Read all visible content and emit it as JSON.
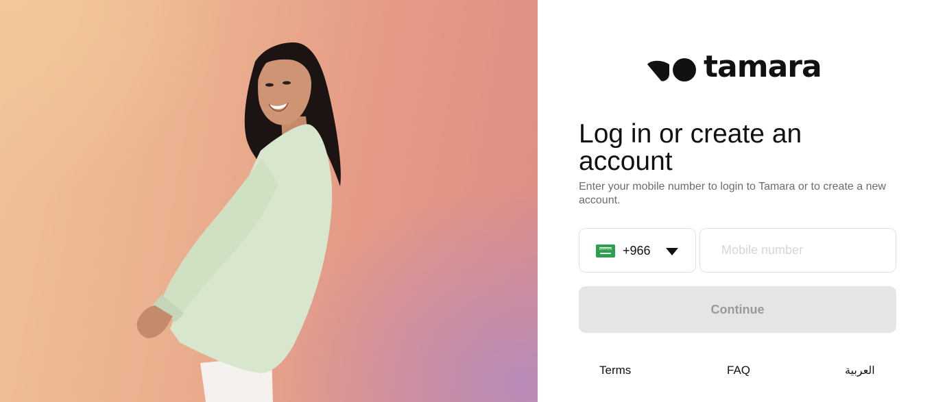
{
  "brand": {
    "name": "tamara",
    "logo_icon": "tamara-logo-icon"
  },
  "hero": {
    "image": "woman-in-mint-cardigan-photo"
  },
  "login": {
    "title": "Log in or create an account",
    "subtitle": "Enter your mobile number to login to Tamara or to create a new account.",
    "country": {
      "flag_icon": "saudi-flag-icon",
      "dial_code": "+966",
      "dropdown_icon": "caret-down-icon"
    },
    "mobile": {
      "placeholder": "Mobile number",
      "value": ""
    },
    "continue_label": "Continue"
  },
  "footer": {
    "terms": "Terms",
    "faq": "FAQ",
    "language": "العربية"
  },
  "colors": {
    "button_disabled_bg": "#e5e5e5",
    "button_disabled_text": "#9a9a9a",
    "border": "#e2e2e2",
    "flag_green": "#2e9e4f"
  }
}
